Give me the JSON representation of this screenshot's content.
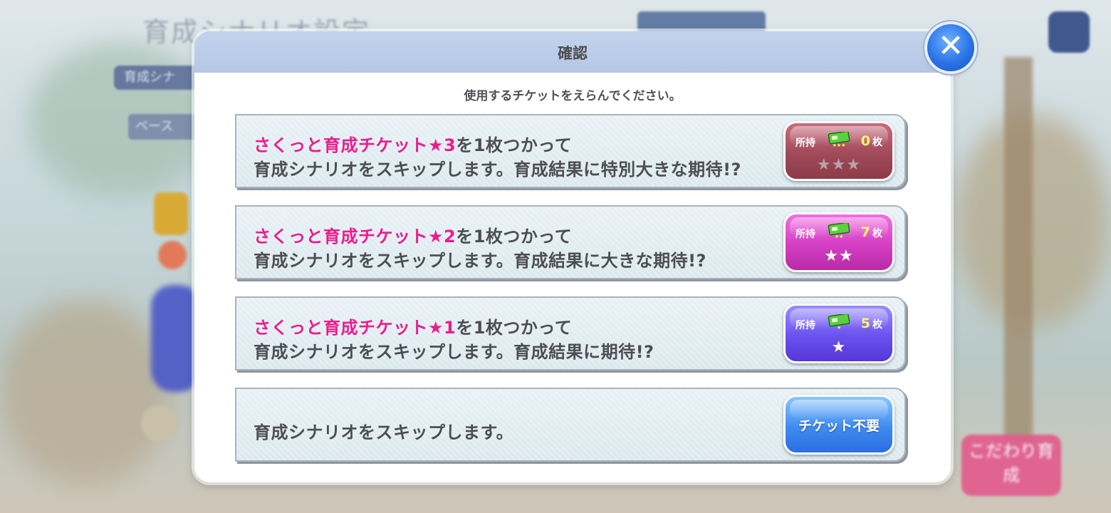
{
  "background": {
    "title": "育成シナリオ設定",
    "tab_label": "育成シナ",
    "sub_label": "ベース",
    "corner_button": "こだわり育成"
  },
  "dialog": {
    "title": "確認",
    "instruction": "使用するチケットをえらんでください。",
    "options": [
      {
        "ticket_name": "さくっと育成チケット★3",
        "line1_suffix": "を1枚つかって",
        "line2": "育成シナリオをスキップします。育成結果に特別大きな期待!?",
        "own_label": "所持",
        "count": "0",
        "count_unit": "枚",
        "stars": "★★★",
        "ticket_stars": "★★★"
      },
      {
        "ticket_name": "さくっと育成チケット★2",
        "line1_suffix": "を1枚つかって",
        "line2": "育成シナリオをスキップします。育成結果に大きな期待!?",
        "own_label": "所持",
        "count": "7",
        "count_unit": "枚",
        "stars": "★★",
        "ticket_stars": "★★"
      },
      {
        "ticket_name": "さくっと育成チケット★1",
        "line1_suffix": "を1枚つかって",
        "line2": "育成シナリオをスキップします。育成結果に期待!?",
        "own_label": "所持",
        "count": "5",
        "count_unit": "枚",
        "stars": "★",
        "ticket_stars": "★"
      }
    ],
    "no_ticket_option": {
      "text": "育成シナリオをスキップします。",
      "button_label": "チケット不要"
    }
  },
  "colors": {
    "ticket_name": "#ec1c8d",
    "header_bg": "#b5c7e6",
    "btn_star3": "#a14a59",
    "btn_star2": "#d43fc4",
    "btn_star1": "#6a52ee",
    "btn_no_ticket": "#3f8bf0",
    "count_highlight": "#fff46b"
  },
  "icons": [
    "close-icon",
    "ticket-icon"
  ]
}
